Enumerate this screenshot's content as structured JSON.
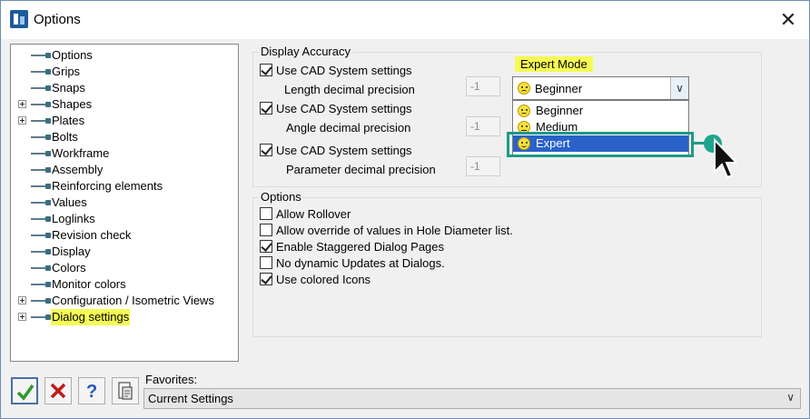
{
  "window": {
    "title": "Options",
    "close_glyph": "✕"
  },
  "tree": {
    "items": [
      {
        "label": "Options",
        "expandable": false,
        "highlight": false
      },
      {
        "label": "Grips",
        "expandable": false,
        "highlight": false
      },
      {
        "label": "Snaps",
        "expandable": false,
        "highlight": false
      },
      {
        "label": "Shapes",
        "expandable": true,
        "highlight": false
      },
      {
        "label": "Plates",
        "expandable": true,
        "highlight": false
      },
      {
        "label": "Bolts",
        "expandable": false,
        "highlight": false
      },
      {
        "label": "Workframe",
        "expandable": false,
        "highlight": false
      },
      {
        "label": "Assembly",
        "expandable": false,
        "highlight": false
      },
      {
        "label": "Reinforcing elements",
        "expandable": false,
        "highlight": false
      },
      {
        "label": "Values",
        "expandable": false,
        "highlight": false
      },
      {
        "label": "Loglinks",
        "expandable": false,
        "highlight": false
      },
      {
        "label": "Revision check",
        "expandable": false,
        "highlight": false
      },
      {
        "label": "Display",
        "expandable": false,
        "highlight": false
      },
      {
        "label": "Colors",
        "expandable": false,
        "highlight": false
      },
      {
        "label": "Monitor colors",
        "expandable": false,
        "highlight": false
      },
      {
        "label": "Configuration / Isometric Views",
        "expandable": true,
        "highlight": false
      },
      {
        "label": "Dialog settings",
        "expandable": true,
        "highlight": true
      }
    ]
  },
  "display_accuracy": {
    "title": "Display Accuracy",
    "rows": [
      {
        "checkbox_label": "Use CAD System settings",
        "checked": true,
        "field_label": "Length decimal precision",
        "value": "-1"
      },
      {
        "checkbox_label": "Use CAD System settings",
        "checked": true,
        "field_label": "Angle decimal precision",
        "value": "-1"
      },
      {
        "checkbox_label": "Use CAD System settings",
        "checked": true,
        "field_label": "Parameter decimal precision",
        "value": "-1"
      }
    ]
  },
  "expert_mode": {
    "label": "Expert Mode",
    "selected": "Beginner",
    "options": [
      {
        "label": "Beginner",
        "face": "sad"
      },
      {
        "label": "Medium",
        "face": "flat"
      },
      {
        "label": "Expert",
        "face": "happy"
      }
    ],
    "highlighted_option": "Expert"
  },
  "options_group": {
    "title": "Options",
    "items": [
      {
        "label": "Allow Rollover",
        "checked": false
      },
      {
        "label": "Allow override of values in Hole Diameter list.",
        "checked": false
      },
      {
        "label": "Enable Staggered Dialog Pages",
        "checked": true
      },
      {
        "label": "No dynamic Updates at Dialogs.",
        "checked": false
      },
      {
        "label": "Use colored Icons",
        "checked": true
      }
    ]
  },
  "favorites": {
    "label": "Favorites:",
    "value": "Current Settings"
  },
  "toolbar": {
    "buttons": [
      {
        "name": "ok-button",
        "icon": "checkmark-icon",
        "color": "#2e9a2e"
      },
      {
        "name": "cancel-button",
        "icon": "x-icon",
        "color": "#c01818"
      },
      {
        "name": "help-button",
        "icon": "question-icon",
        "color": "#2456b8"
      },
      {
        "name": "favorites-button",
        "icon": "document-icon",
        "color": "#5a5a5a"
      }
    ]
  },
  "colors": {
    "highlight": "#f6fb54",
    "selection": "#2a62c9",
    "annotation": "#1e9a86"
  }
}
